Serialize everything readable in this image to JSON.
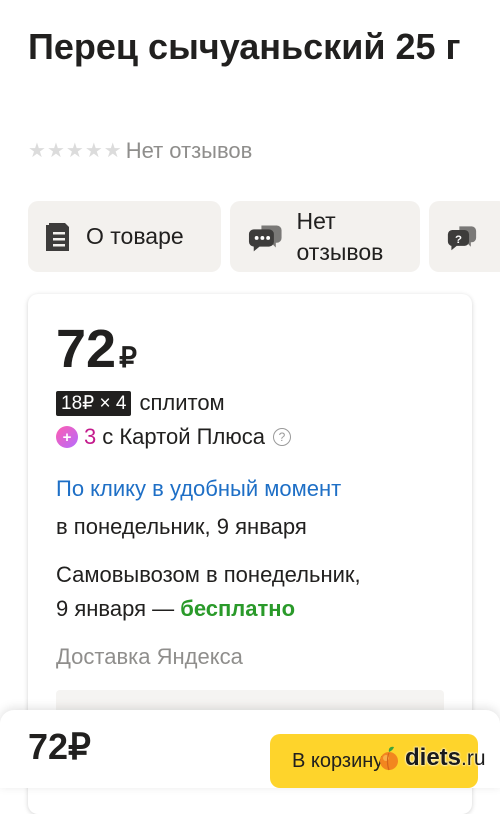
{
  "product": {
    "title": "Перец сычуаньский 25 г",
    "rating_text": "Нет отзывов",
    "stars": 5
  },
  "tabs": [
    {
      "label": "О товаре",
      "icon": "document-icon"
    },
    {
      "label": "Нет отзывов",
      "icon": "chat-bubbles-icon"
    },
    {
      "label": "",
      "icon": "question-bubble-icon"
    }
  ],
  "offer": {
    "price": "72",
    "currency": "₽",
    "split_badge": "18₽ × 4",
    "split_text": "сплитом",
    "plus_num": "3",
    "plus_text": "с Картой Плюса",
    "delivery_link": "По клику в удобный момент",
    "delivery_date": "в понедельник, 9 января",
    "pickup_line1": "Самовывозом в понедельник,",
    "pickup_line2_prefix": "9 января —",
    "pickup_free": "бесплатно",
    "delivery_service": "Доставка Яндекса"
  },
  "bottom_bar": {
    "price": "72₽",
    "cart_button": "В корзину"
  },
  "watermark": {
    "text": "diets",
    "tld": ".ru"
  },
  "colors": {
    "accent_yellow": "#fed42b",
    "link_blue": "#1e6fc6",
    "free_green": "#2a9a2a",
    "plus_magenta": "#c41a8c",
    "tab_bg": "#f3f1ee"
  }
}
